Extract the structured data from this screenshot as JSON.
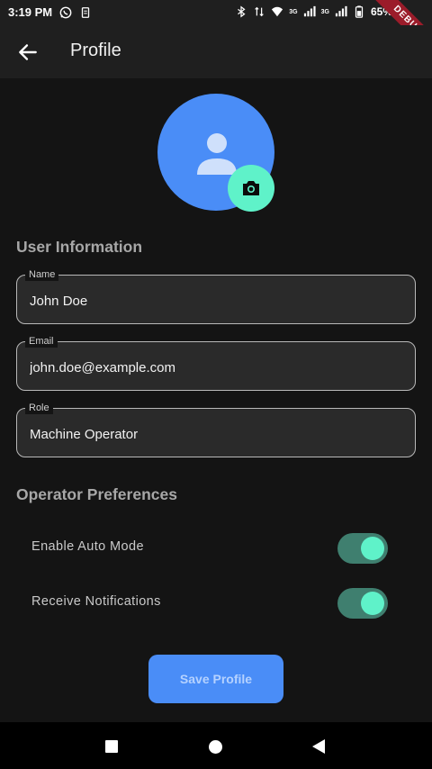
{
  "status_bar": {
    "time": "3:19 PM",
    "battery": "65%",
    "network_1": "3G",
    "network_2": "3G",
    "debug_label": "DEBUG",
    "icons": [
      "whatsapp-icon",
      "sim-icon",
      "bluetooth-icon",
      "data-arrows-icon",
      "wifi-icon",
      "signal-icon",
      "battery-icon"
    ]
  },
  "app_bar": {
    "title": "Profile",
    "back_icon": "arrow-left-icon"
  },
  "avatar": {
    "icon": "person-icon",
    "edit_icon": "camera-icon"
  },
  "user_information": {
    "heading": "User Information",
    "fields": [
      {
        "label": "Name",
        "value": "John Doe"
      },
      {
        "label": "Email",
        "value": "john.doe@example.com"
      },
      {
        "label": "Role",
        "value": "Machine Operator"
      }
    ]
  },
  "operator_preferences": {
    "heading": "Operator Preferences",
    "toggles": [
      {
        "label": "Enable Auto Mode",
        "on": true
      },
      {
        "label": "Receive Notifications",
        "on": true
      }
    ]
  },
  "save_button": {
    "label": "Save Profile"
  },
  "colors": {
    "accent": "#4a8df7",
    "secondary": "#5ff2c9",
    "background": "#141414",
    "surface": "#1f1f1f"
  }
}
